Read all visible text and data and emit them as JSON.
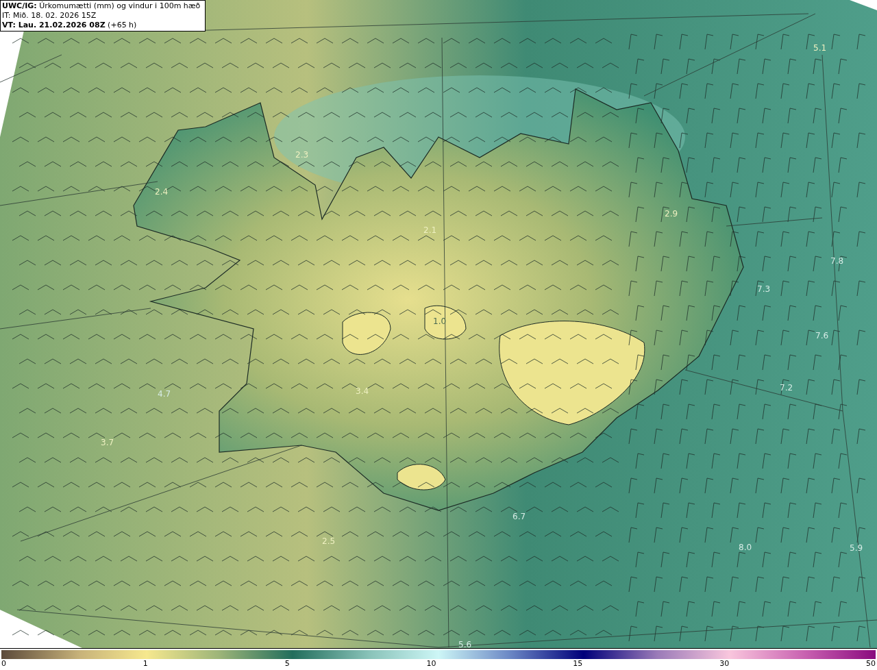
{
  "title_box": {
    "lines": [
      "**UWC/IG:** Úrkomumætti (mm) og vindur i 100m hæð",
      "IT: Mið. 18. 02. 2026 15Z",
      "**VT: Lau. 21.02.2026 08Z** (+65 h)"
    ]
  },
  "map": {
    "value_labels": [
      {
        "text": "5.1"
      },
      {
        "text": "2.3"
      },
      {
        "text": "2.4"
      },
      {
        "text": "2.1"
      },
      {
        "text": "2.9"
      },
      {
        "text": "7.8"
      },
      {
        "text": "7.3"
      },
      {
        "text": "1.0"
      },
      {
        "text": "7.6"
      },
      {
        "text": "7.2"
      },
      {
        "text": "4.7"
      },
      {
        "text": "3.4"
      },
      {
        "text": "3.7"
      },
      {
        "text": "6.7"
      },
      {
        "text": "2.5"
      },
      {
        "text": "8.0"
      },
      {
        "text": "5.9"
      },
      {
        "text": "5.6"
      }
    ]
  },
  "colorbar": {
    "ticks": [
      "0",
      "1",
      "5",
      "10",
      "15",
      "30",
      "50"
    ]
  }
}
